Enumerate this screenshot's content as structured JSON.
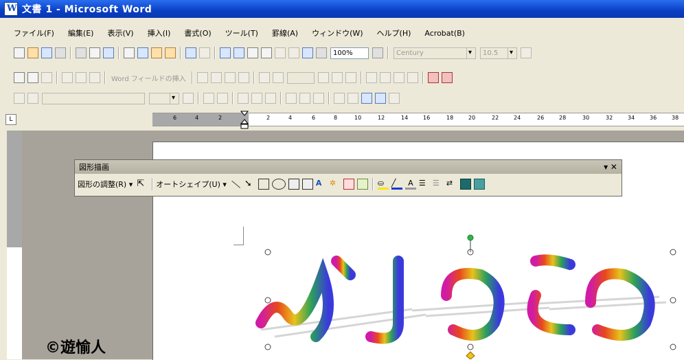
{
  "window": {
    "title": "文書 1 - Microsoft Word"
  },
  "menu": {
    "items": [
      "ファイル(F)",
      "編集(E)",
      "表示(V)",
      "挿入(I)",
      "書式(O)",
      "ツール(T)",
      "罫線(A)",
      "ウィンドウ(W)",
      "ヘルプ(H)",
      "Acrobat(B)"
    ]
  },
  "toolbar1": {
    "zoom": "100%",
    "font": "Century",
    "size": "10.5"
  },
  "toolbar2": {
    "word_field": "Word フィールドの挿入"
  },
  "ruler": {
    "ticks": [
      "6",
      "4",
      "2",
      "2",
      "4",
      "6",
      "8",
      "10",
      "12",
      "14",
      "16",
      "18",
      "20",
      "22",
      "24",
      "26",
      "28",
      "30",
      "32",
      "34",
      "36",
      "38"
    ]
  },
  "drawing": {
    "title": "図形描画",
    "adjust": "図形の調整(R) ▾",
    "autoshape": "オートシェイプ(U) ▾"
  },
  "wordart": {
    "text": "ふじゆこめ",
    "colors": [
      "#d11ba5",
      "#e8481c",
      "#e8c21c",
      "#2aa05a",
      "#3a3adc"
    ]
  },
  "watermark": "©遊愉人"
}
